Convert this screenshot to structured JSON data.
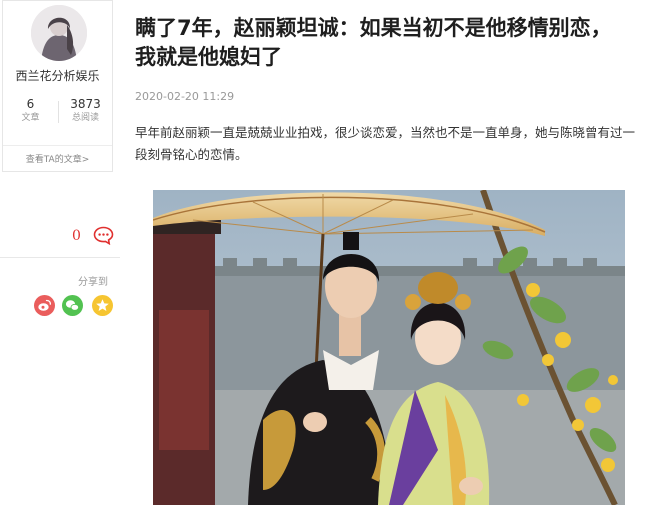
{
  "author": {
    "name": "西兰花分析娱乐",
    "articles_count": "6",
    "articles_label": "文章",
    "reads_count": "3873",
    "reads_label": "总阅读",
    "view_articles_link": "查看TA的文章>"
  },
  "sidebar": {
    "comment_count": "0",
    "share_label": "分享到",
    "share_targets": [
      "weibo-icon",
      "wechat-icon",
      "favorite-star-icon"
    ]
  },
  "article": {
    "title_line1": "瞒了7年，赵丽颖坦诚：如果当初不是他移情别恋，",
    "title_line2": "我就是他媳妇了",
    "date": "2020-02-20 11:29",
    "paragraph": "早年前赵丽颖一直是兢兢业业拍戏，很少谈恋爱，当然也不是一直单身，她与陈晓曾有过一段刻骨铭心的恋情。"
  },
  "colors": {
    "accent_red": "#e0302f",
    "weibo": "#ea5d5c",
    "wechat": "#52c251",
    "favorite": "#f6c531"
  }
}
